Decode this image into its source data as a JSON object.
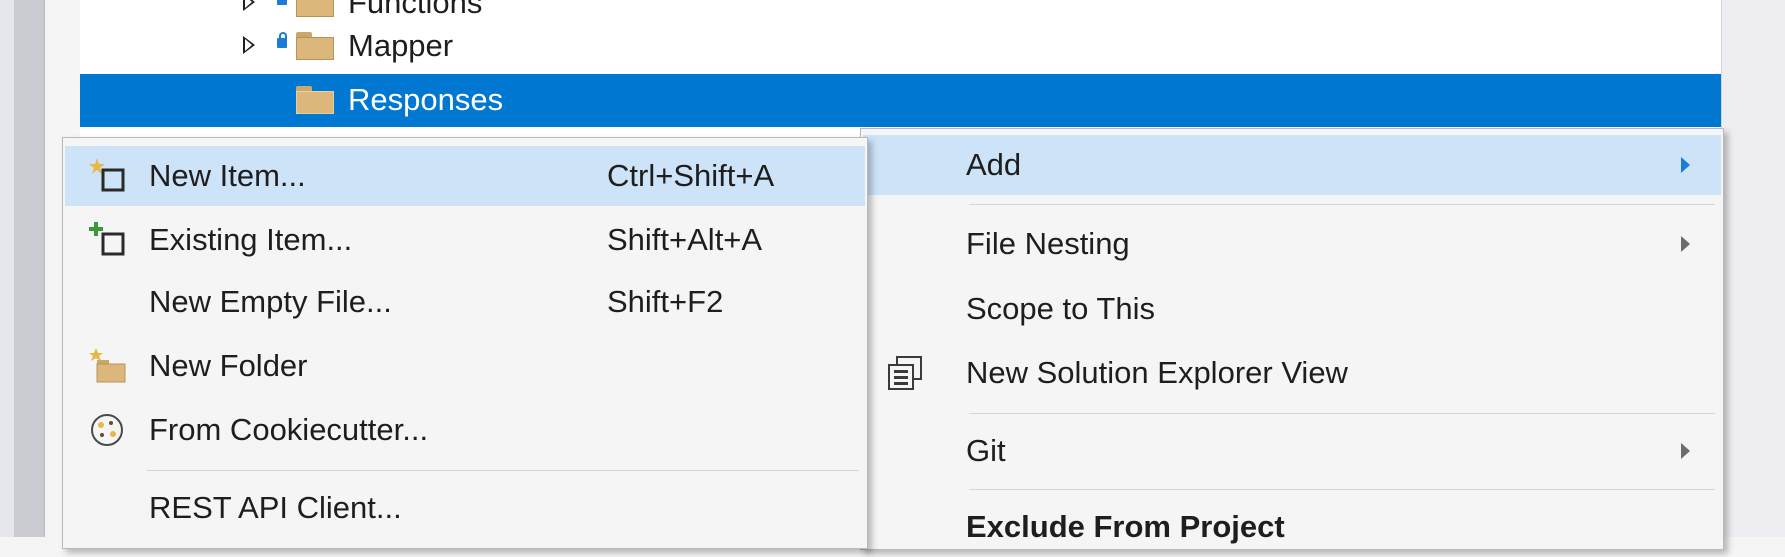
{
  "tree": {
    "items": [
      {
        "label": "Functions",
        "expandable": true,
        "locked": true
      },
      {
        "label": "Mapper",
        "expandable": true,
        "locked": true
      },
      {
        "label": "Responses",
        "expandable": false,
        "locked": false,
        "selected": true
      }
    ]
  },
  "context_menu": {
    "items": [
      {
        "label": "Add",
        "submenu": true,
        "highlighted": true
      },
      {
        "label": "File Nesting",
        "submenu": true
      },
      {
        "label": "Scope to This"
      },
      {
        "label": "New Solution Explorer View",
        "icon": "solution-explorer-view-icon"
      },
      {
        "label": "Git",
        "submenu": true
      },
      {
        "label": "Exclude From Project"
      }
    ]
  },
  "add_submenu": {
    "items": [
      {
        "label": "New Item...",
        "shortcut": "Ctrl+Shift+A",
        "icon": "new-item-icon",
        "highlighted": true
      },
      {
        "label": "Existing Item...",
        "shortcut": "Shift+Alt+A",
        "icon": "existing-item-icon"
      },
      {
        "label": "New Empty File...",
        "shortcut": "Shift+F2"
      },
      {
        "label": "New Folder",
        "icon": "new-folder-icon"
      },
      {
        "label": "From Cookiecutter...",
        "icon": "cookiecutter-icon"
      },
      {
        "label": "REST API Client..."
      }
    ]
  },
  "colors": {
    "selection": "#0077d0",
    "menu_highlight": "#cde3f7",
    "menu_background": "#f5f5f5",
    "accent_arrow": "#1c7bd6"
  }
}
